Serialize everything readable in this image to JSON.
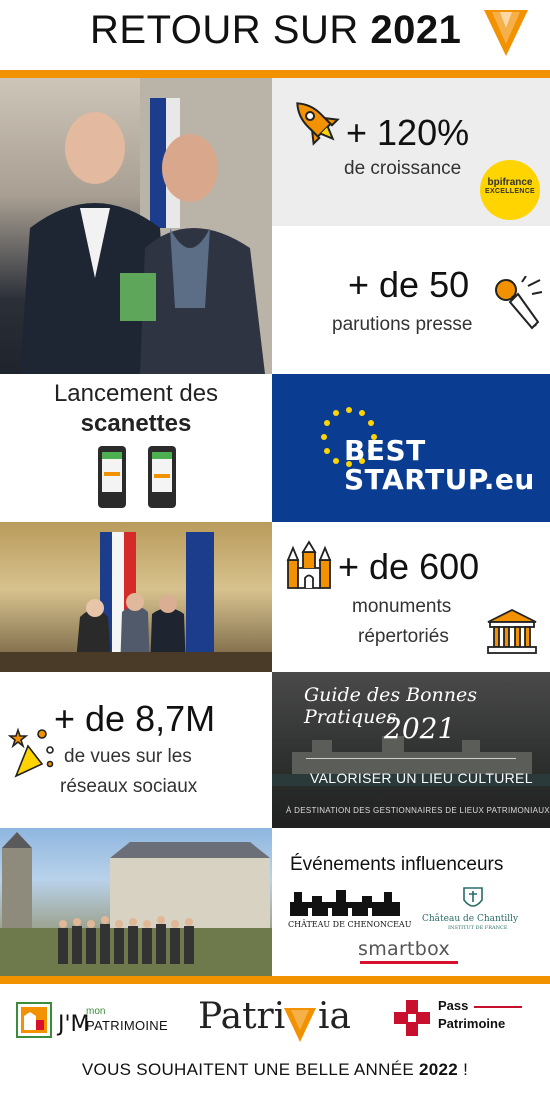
{
  "header": {
    "title_prefix": "RETOUR SUR ",
    "title_year": "2021"
  },
  "stats": {
    "growth": {
      "value": "+ 120%",
      "label": "de croissance"
    },
    "bpi": {
      "line1": "bpifrance",
      "line2": "EXCELLENCE"
    },
    "press": {
      "value": "+ de 50",
      "label": "parutions presse"
    },
    "scanettes": {
      "line1": "Lancement des",
      "line2": "scanettes"
    },
    "best_startup": {
      "line1": "BEST",
      "line2": "STARTUP.eu"
    },
    "monuments": {
      "value": "+ de 600",
      "line1": "monuments",
      "line2": "répertoriés"
    },
    "views": {
      "value": "+ de 8,7M",
      "line1": "de vues sur les",
      "line2": "réseaux sociaux"
    }
  },
  "guide": {
    "title": "Guide des Bonnes Pratiques",
    "year": "2021",
    "subtitle": "VALORISER UN LIEU CULTUREL",
    "small": "À DESTINATION DES GESTIONNAIRES DE LIEUX PATRIMONIAUX"
  },
  "events": {
    "title": "Événements influenceurs",
    "chenonceau": "CHÂTEAU DE CHENONCEAU",
    "chantilly": "Château de Chantilly",
    "chantilly_sub": "INSTITUT DE FRANCE",
    "smartbox": "smartbox"
  },
  "partners": {
    "jm_prefix": "J'M",
    "jm_mon": "mon",
    "jm_name": "PATRIMOINE",
    "patrivia_a": "Patri",
    "patrivia_b": "ia",
    "pass_line1": "Pass",
    "pass_line2": "Patrimoine"
  },
  "footer": {
    "message_prefix": "VOUS SOUHAITENT UNE BELLE ANNÉE ",
    "message_year": "2022",
    "message_suffix": " !"
  },
  "colors": {
    "orange": "#f39200",
    "eu_blue": "#0a3d91",
    "eu_star": "#ffd400",
    "pass_red": "#c8102e"
  }
}
